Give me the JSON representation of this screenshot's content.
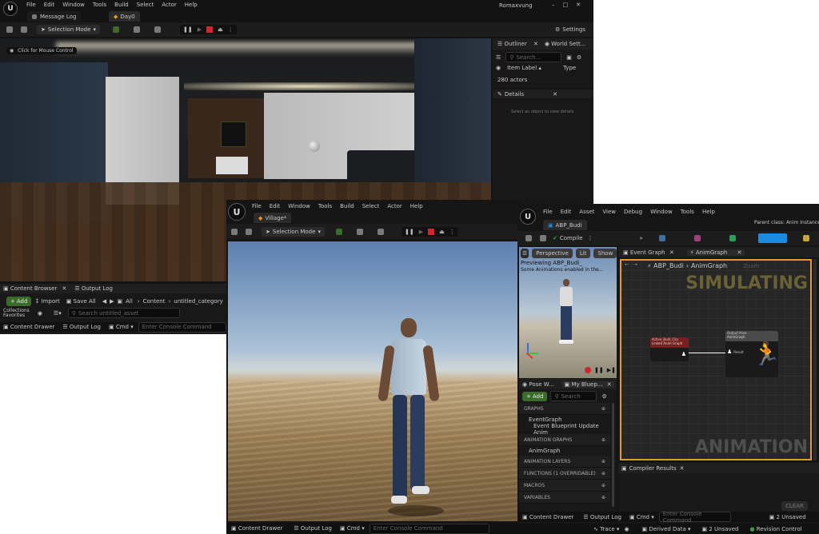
{
  "window1": {
    "menu": [
      "File",
      "Edit",
      "Window",
      "Tools",
      "Build",
      "Select",
      "Actor",
      "Help"
    ],
    "tabs": [
      "Message Log",
      "Day0"
    ],
    "user": "Romaxvung",
    "toolbar": {
      "selection_mode": "Selection Mode",
      "settings": "Settings"
    },
    "viewport_hint": "Click for Mouse Control",
    "outliner": {
      "tab": "Outliner",
      "tab2": "World Sett...",
      "search_placeholder": "Search...",
      "col_label": "Item Label ▴",
      "col_type": "Type",
      "count": "280 actors"
    },
    "details": {
      "tab": "Details",
      "empty": "Select an object to view details."
    },
    "content_browser": {
      "tab": "Content Browser",
      "tab2": "Output Log",
      "add": "Add",
      "import": "Import",
      "save_all": "Save All",
      "path": [
        "All",
        "Content",
        "untitled_category"
      ],
      "collections": "Collections",
      "favorites": "Favorites",
      "search_placeholder": "Search untitled_asset"
    },
    "statusbar": {
      "content_drawer": "Content Drawer",
      "output_log": "Output Log",
      "cmd": "Cmd",
      "console": "Enter Console Command"
    }
  },
  "window2": {
    "menu": [
      "File",
      "Edit",
      "Window",
      "Tools",
      "Build",
      "Select",
      "Actor",
      "Help"
    ],
    "tab": "Village*",
    "toolbar": {
      "selection_mode": "Selection Mode"
    },
    "statusbar": {
      "content_drawer": "Content Drawer",
      "output_log": "Output Log",
      "cmd": "Cmd",
      "console": "Enter Console Command"
    }
  },
  "window3": {
    "menu": [
      "File",
      "Edit",
      "Asset",
      "View",
      "Debug",
      "Window",
      "Tools",
      "Help"
    ],
    "tab": "ABP_Budi",
    "parent_class": "Parent class: Anim Instance",
    "compile": "Compile",
    "preview": {
      "perspective": "Perspective",
      "lit": "Lit",
      "show": "Show",
      "line1": "Previewing ABP_Budi_",
      "line2": "Some Animations enabled in the..."
    },
    "graph_tabs": [
      "Event Graph",
      "AnimGraph"
    ],
    "breadcrumb": [
      "ABP_Budi",
      "AnimGraph"
    ],
    "zoom": "Zoom",
    "watermark_top": "SIMULATING",
    "watermark_bottom": "ANIMATION",
    "nodes": {
      "source_title": "Active_Budi_Clip",
      "source_sub": "Linked Anim Graph",
      "output_title": "Output Pose",
      "output_sub": "AnimGraph",
      "result": "Result"
    },
    "mybp": {
      "tab1": "Pose W...",
      "tab2": "My Bluep...",
      "add": "Add",
      "search_placeholder": "Search",
      "sections": [
        {
          "label": "GRAPHS"
        },
        {
          "label": "EventGraph",
          "indent": 1
        },
        {
          "label": "Event Blueprint Update Anim",
          "indent": 2
        },
        {
          "label": "ANIMATION GRAPHS"
        },
        {
          "label": "AnimGraph",
          "indent": 1
        },
        {
          "label": "ANIMATION LAYERS"
        },
        {
          "label": "FUNCTIONS (1 OVERRIDABLE)"
        },
        {
          "label": "MACROS"
        },
        {
          "label": "VARIABLES"
        }
      ]
    },
    "compiler": {
      "tab": "Compiler Results",
      "clear": "CLEAR"
    },
    "statusbar": {
      "content_drawer": "Content Drawer",
      "output_log": "Output Log",
      "cmd": "Cmd",
      "console": "Enter Console Command",
      "unsaved": "2 Unsaved",
      "trace": "Trace",
      "derived": "Derived Data",
      "unsaved2": "2 Unsaved",
      "revision": "Revision Control"
    }
  },
  "colors": {
    "accent_orange": "#e8971f",
    "accent_blue": "#1b8be0",
    "record_red": "#d0262a",
    "add_green": "#3a6b2a"
  }
}
